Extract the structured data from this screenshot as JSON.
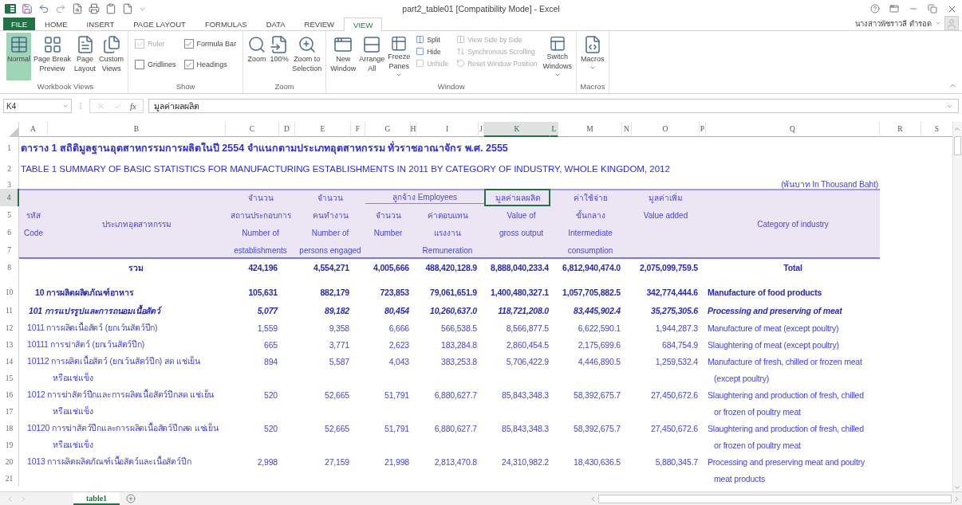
{
  "window": {
    "title": "part2_table01  [Compatibility Mode] - Excel",
    "user": "นางสาวพัชราวลี ดำรอด"
  },
  "ribbon_tabs": [
    {
      "label": "FILE",
      "kind": "file",
      "selected": false
    },
    {
      "label": "HOME",
      "kind": "tab",
      "selected": false
    },
    {
      "label": "INSERT",
      "kind": "tab",
      "selected": false
    },
    {
      "label": "PAGE LAYOUT",
      "kind": "tab",
      "selected": false
    },
    {
      "label": "FORMULAS",
      "kind": "tab",
      "selected": false
    },
    {
      "label": "DATA",
      "kind": "tab",
      "selected": false
    },
    {
      "label": "REVIEW",
      "kind": "tab",
      "selected": false
    },
    {
      "label": "VIEW",
      "kind": "tab",
      "selected": true
    }
  ],
  "ribbon_groups": [
    {
      "label": "Workbook Views",
      "items": [
        {
          "kind": "large",
          "lines": [
            "Normal"
          ],
          "selected": true
        },
        {
          "kind": "large",
          "lines": [
            "Page Break",
            "Preview"
          ],
          "selected": false
        },
        {
          "kind": "large",
          "lines": [
            "Page",
            "Layout"
          ],
          "selected": false
        },
        {
          "kind": "large",
          "lines": [
            "Custom",
            "Views"
          ],
          "selected": false
        }
      ]
    },
    {
      "label": "Show",
      "items": [
        {
          "kind": "stack",
          "items": [
            {
              "kind": "check",
              "label": "Ruler",
              "checked": true,
              "disabled": true
            },
            {
              "kind": "check",
              "label": "Gridlines",
              "checked": false,
              "disabled": false
            }
          ]
        },
        {
          "kind": "stack",
          "items": [
            {
              "kind": "check",
              "label": "Formula Bar",
              "checked": true,
              "disabled": false
            },
            {
              "kind": "check",
              "label": "Headings",
              "checked": true,
              "disabled": false
            }
          ]
        }
      ]
    },
    {
      "label": "Zoom",
      "items": [
        {
          "kind": "large",
          "lines": [
            "Zoom"
          ]
        },
        {
          "kind": "large",
          "lines": [
            "100%"
          ]
        },
        {
          "kind": "large",
          "lines": [
            "Zoom to",
            "Selection"
          ]
        }
      ]
    },
    {
      "label": "Window",
      "items": [
        {
          "kind": "large",
          "lines": [
            "New",
            "Window"
          ]
        },
        {
          "kind": "large",
          "lines": [
            "Arrange",
            "All"
          ]
        },
        {
          "kind": "large",
          "lines": [
            "Freeze",
            "Panes"
          ],
          "dropdown": true
        },
        {
          "kind": "stack",
          "items": [
            {
              "kind": "small",
              "label": "Split",
              "disabled": false
            },
            {
              "kind": "small",
              "label": "Hide",
              "disabled": false
            },
            {
              "kind": "small",
              "label": "Unhide",
              "disabled": true
            }
          ]
        },
        {
          "kind": "stack",
          "items": [
            {
              "kind": "small",
              "label": "View Side by Side",
              "disabled": true
            },
            {
              "kind": "small",
              "label": "Synchronous Scrolling",
              "disabled": true
            },
            {
              "kind": "small",
              "label": "Reset Window Position",
              "disabled": true
            }
          ]
        },
        {
          "kind": "large",
          "lines": [
            "Switch",
            "Windows"
          ],
          "dropdown": true
        }
      ]
    },
    {
      "label": "Macros",
      "items": [
        {
          "kind": "large",
          "lines": [
            "Macros"
          ],
          "dropdown": true
        }
      ]
    }
  ],
  "formula_bar": {
    "name_box": "K4",
    "function_label": "fx",
    "value": "มูลค่าผลผลิต"
  },
  "columns": [
    {
      "label": "A",
      "selected": false
    },
    {
      "label": "B",
      "selected": false
    },
    {
      "label": "C",
      "selected": false
    },
    {
      "label": "D",
      "selected": false
    },
    {
      "label": "E",
      "selected": false
    },
    {
      "label": "F",
      "selected": false
    },
    {
      "label": "G",
      "selected": false
    },
    {
      "label": "H",
      "selected": false
    },
    {
      "label": "I",
      "selected": false
    },
    {
      "label": "J",
      "selected": false
    },
    {
      "label": "K",
      "selected": true
    },
    {
      "label": "L",
      "selected": true
    },
    {
      "label": "M",
      "selected": false
    },
    {
      "label": "N",
      "selected": false
    },
    {
      "label": "O",
      "selected": false
    },
    {
      "label": "P",
      "selected": false
    },
    {
      "label": "Q",
      "selected": false
    },
    {
      "label": "R",
      "selected": false
    },
    {
      "label": "S",
      "selected": false
    }
  ],
  "rows": [
    {
      "kind": "title",
      "number": "1",
      "selected": false,
      "text": "ตาราง  1 สถิติมูลฐานอุตสาหกรรมการผลิตในปี 2554 จำแนกตามประเภทอุตสาหกรรม ทั่วราชอาณาจักร พ.ศ. 2555"
    },
    {
      "kind": "subtitle",
      "number": "2",
      "selected": false,
      "text": "TABLE 1 SUMMARY OF BASIC STATISTICS FOR MANUFACTURING ESTABLISHMENTS IN 2011 BY  CATEGORY OF INDUSTRY, WHOLE KINGDOM, 2012"
    },
    {
      "kind": "units",
      "number": "3",
      "selected": false,
      "note": "(พันบาท In Thousand Baht)"
    },
    {
      "kind": "header",
      "numbers": [
        {
          "label": "4",
          "selected": true
        },
        {
          "label": "5",
          "selected": false
        },
        {
          "label": "6",
          "selected": false
        },
        {
          "label": "7",
          "selected": false
        }
      ],
      "code": [
        "รหัส",
        "Code"
      ],
      "industry": "ประเภทอุตสาหกรรม",
      "establishments": [
        "จำนวน",
        "สถานประกอบการ",
        "Number of",
        "establishments"
      ],
      "persons": [
        "จำนวน",
        "คนทำงาน",
        "Number of",
        "persons engaged"
      ],
      "employees": "ลูกจ้าง Employees",
      "employees_number": [
        "จำนวน",
        "Number"
      ],
      "remuneration": [
        "ค่าตอบแทน",
        "แรงงาน",
        "Remuneration"
      ],
      "gross_output": {
        "title": "มูลค่าผลผลิต",
        "selected": true,
        "lines": [
          "Value of",
          "gross output"
        ]
      },
      "intermediate": [
        "ค่าใช้จ่าย",
        "ขั้นกลาง",
        "Intermediate",
        "consumption"
      ],
      "value_added": [
        "มูลค่าเพิ่ม",
        "Value added"
      ],
      "category": "Category of  industry"
    },
    {
      "kind": "total",
      "number": "8",
      "selected": false,
      "industry": "รวม",
      "establishments": "424,196",
      "persons": "4,554,271",
      "employees_number": "4,005,666",
      "remuneration": "488,420,128.9",
      "gross_output": "8,888,040,233.4",
      "intermediate": "6,812,940,474.0",
      "value_added": "2,075,099,759.5",
      "category": "Total"
    },
    {
      "kind": "spacer"
    },
    {
      "kind": "group",
      "number": "10",
      "selected": false,
      "industry": "10 การผลิตผลิตภัณฑ์อาหาร",
      "establishments": "105,631",
      "persons": "882,179",
      "employees_number": "723,853",
      "remuneration": "79,061,651.9",
      "gross_output": "1,400,480,327.1",
      "intermediate": "1,057,705,882.5",
      "value_added": "342,774,444.6",
      "category": "Manufacture of food products"
    },
    {
      "kind": "subgroup",
      "number": "11",
      "selected": false,
      "industry": "101  การแปรรูปและการถนอมเนื้อสัตว์",
      "establishments": "5,077",
      "persons": "89,182",
      "employees_number": "80,454",
      "remuneration": "10,260,637.0",
      "gross_output": "118,721,208.0",
      "intermediate": "83,445,902.4",
      "value_added": "35,275,305.6",
      "category": "Processing and preserving of meat"
    },
    {
      "kind": "item",
      "number": "12",
      "selected": false,
      "industry": "1011 การผลิตเนื้อสัตว์ (ยกเว้นสัตว์ปีก)",
      "establishments": "1,559",
      "persons": "9,358",
      "employees_number": "6,666",
      "remuneration": "566,538.5",
      "gross_output": "8,566,877.5",
      "intermediate": "6,622,590.1",
      "value_added": "1,944,287.3",
      "category": "Manufacture of meat (except poultry)"
    },
    {
      "kind": "item",
      "number": "13",
      "selected": false,
      "industry": "10111 การฆ่าสัตว์ (ยกเว้นสัตว์ปีก)",
      "establishments": "665",
      "persons": "3,771",
      "employees_number": "2,623",
      "remuneration": "183,284.8",
      "gross_output": "2,860,454.5",
      "intermediate": "2,175,699.6",
      "value_added": "684,754.9",
      "category": "Slaughtering of meat (except poultry)"
    },
    {
      "kind": "item",
      "number": "14",
      "selected": false,
      "industry": "10112 การผลิตเนื้อสัตว์ (ยกเว้นสัตว์ปีก) สด แช่เย็น",
      "establishments": "894",
      "persons": "5,587",
      "employees_number": "4,043",
      "remuneration": "383,253.8",
      "gross_output": "5,706,422.9",
      "intermediate": "4,446,890.5",
      "value_added": "1,259,532.4",
      "category": "Manufacture of fresh, chilled or frozen meat"
    },
    {
      "kind": "continuation",
      "number": "15",
      "selected": false,
      "industry": "หรือแช่แข็ง",
      "category": "(except poultry)"
    },
    {
      "kind": "item",
      "number": "16",
      "selected": false,
      "industry": "1012 การฆ่าสัตว์ปีกและการผลิตเนื้อสัตว์ปีกสด แช่เย็น",
      "establishments": "520",
      "persons": "52,665",
      "employees_number": "51,791",
      "remuneration": "6,880,627.7",
      "gross_output": "85,843,348.3",
      "intermediate": "58,392,675.7",
      "value_added": "27,450,672.6",
      "category": "Slaughtering and production of fresh, chilled"
    },
    {
      "kind": "continuation",
      "number": "17",
      "selected": false,
      "industry": "หรือแช่แข็ง",
      "category": "or frozen of poultry meat"
    },
    {
      "kind": "item",
      "number": "18",
      "selected": false,
      "industry": "10120 การฆ่าสัตว์ปีกและการผลิตเนื้อสัตว์ปีกสด แช่เย็น",
      "establishments": "520",
      "persons": "52,665",
      "employees_number": "51,791",
      "remuneration": "6,880,627.7",
      "gross_output": "85,843,348.3",
      "intermediate": "58,392,675.7",
      "value_added": "27,450,672.6",
      "category": "Slaughtering and production of fresh, chilled"
    },
    {
      "kind": "continuation",
      "number": "19",
      "selected": false,
      "industry": "หรือแช่แข็ง",
      "category": "or frozen of poultry meat"
    },
    {
      "kind": "item",
      "number": "20",
      "selected": false,
      "industry": "1013 การผลิตผลิตภัณฑ์เนื้อสัตว์และเนื้อสัตว์ปีก",
      "establishments": "2,998",
      "persons": "27,159",
      "employees_number": "21,998",
      "remuneration": "2,813,470.8",
      "gross_output": "24,310,982.2",
      "intermediate": "18,430,636.5",
      "value_added": "5,880,345.7",
      "category": "Processing and preserving meat and poultry"
    },
    {
      "kind": "continuation",
      "number": "21",
      "selected": false,
      "category": "meat products"
    }
  ],
  "sheet_tabs": [
    {
      "label": "table1",
      "selected": true
    }
  ]
}
